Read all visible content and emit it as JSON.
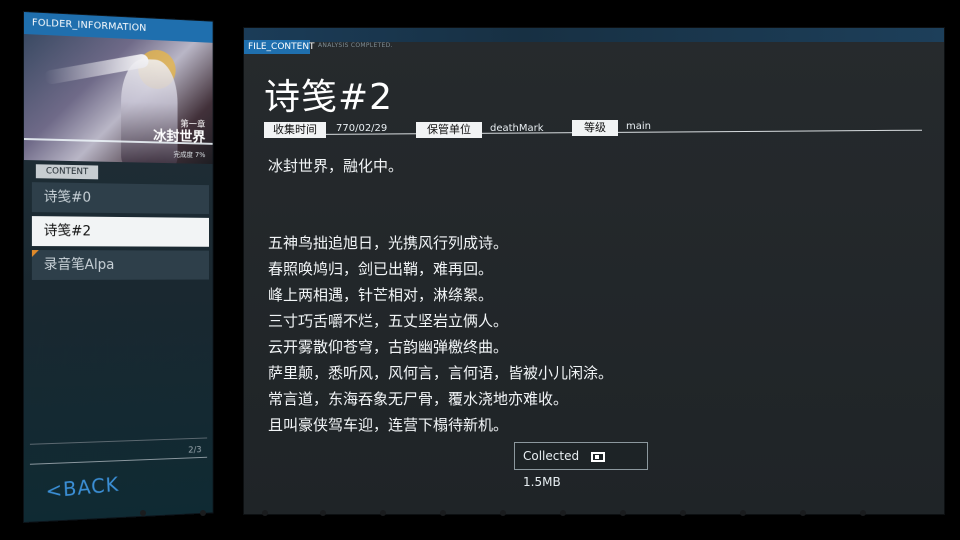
{
  "left_panel": {
    "header": "FOLDER_INFORMATION",
    "cover": {
      "chapter": "第一章",
      "world": "冰封世界",
      "progress": "完成度 7%"
    },
    "content_tag": "CONTENT",
    "items": [
      {
        "label": "诗笺#0"
      },
      {
        "label": "诗笺#2"
      },
      {
        "label": "录音笔Alpa"
      }
    ],
    "page_count": "2/3",
    "back_label": "<BACK"
  },
  "main": {
    "file_tag": "FILE_CONTENT",
    "analysis": "ANALYSIS COMPLETED.",
    "title": "诗笺#2",
    "meta": {
      "collect_time_label": "收集时间",
      "collect_time_value": "770/02/29",
      "custodian_label": "保管单位",
      "custodian_value": "deathMark",
      "level_label": "等级",
      "level_value": "main"
    },
    "intro": "冰封世界，融化中。",
    "poem": [
      "五神鸟拙追旭日，光携风行列成诗。",
      "春照唤鸠归，剑已出鞘，难再回。",
      "峰上两相遇，针芒相对，淋绦絮。",
      "三寸巧舌嚼不烂，五丈坚岩立俩人。",
      "云开雾散仰苍穹，古韵幽弹檄终曲。",
      "萨里颠，悉听风，风何言，言何语，皆被小儿闲涂。",
      "常言道，东海吞象无尸骨，覆水浇地亦难收。",
      "且叫豪侠驾车迎，连营下榻待新机。"
    ],
    "collected": {
      "label": "Collected",
      "size": "1.5MB"
    }
  },
  "colors": {
    "accent_blue": "#1f6fae",
    "back_blue": "#3b8fd6",
    "active_item_bg": "#f2f4f5",
    "corner_orange": "#e08a2a"
  }
}
